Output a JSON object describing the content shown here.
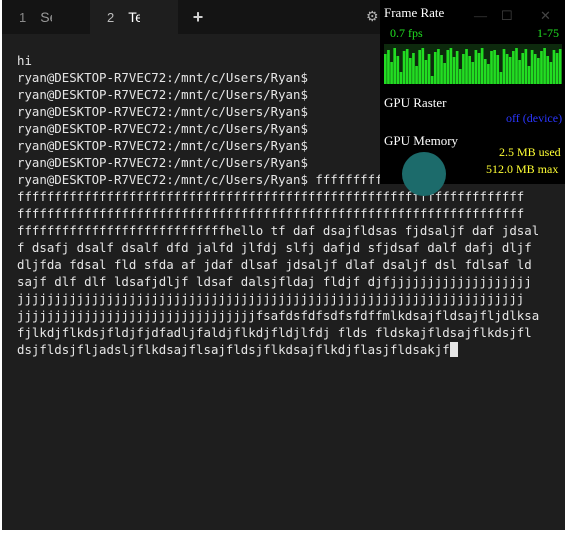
{
  "tabs": [
    {
      "number": "1",
      "title": "Se"
    },
    {
      "number": "2",
      "title": "Te"
    }
  ],
  "new_tab_icon": "+",
  "terminal_lines": [
    "hi",
    "ryan@DESKTOP-R7VEC72:/mnt/c/Users/Ryan$",
    "ryan@DESKTOP-R7VEC72:/mnt/c/Users/Ryan$",
    "ryan@DESKTOP-R7VEC72:/mnt/c/Users/Ryan$",
    "ryan@DESKTOP-R7VEC72:/mnt/c/Users/Ryan$",
    "ryan@DESKTOP-R7VEC72:/mnt/c/Users/Ryan$",
    "ryan@DESKTOP-R7VEC72:/mnt/c/Users/Ryan$",
    "ryan@DESKTOP-R7VEC72:/mnt/c/Users/Ryan$ ffffffffffffffffffffffffffffffff",
    "ffffffffffffffffffffffffffffffffffffffffffffffffffffffffffffffffffff",
    "ffffffffffffffffffffffffffffffffffffffffffffffffffffffffffffffffffff",
    "ffffffffffffffffffffffffffffhello tf daf dsajfldsas fjdsaljf daf jdsal",
    "f dsafj dsalf dsalf dfd jalfd jlfdj slfj dafjd sfjdsaf dalf dafj dljf",
    "dljfda fdsal fld sfda af jdaf dlsaf jdsaljf dlaf dsaljf dsl fdlsaf ld",
    "sajf dlf dlf ldsafjdljf ldsaf dalsjfldaj fldjf djfjjjjjjjjjjjjjjjjjjj",
    "jjjjjjjjjjjjjjjjjjjjjjjjjjjjjjjjjjjjjjjjjjjjjjjjjjjjjjjjjjjjjjjjjjjj",
    "jjjjjjjjjjjjjjjjjjjjjjjjjjjjjjjjfsafdsfdfsdfsfdffmlkdsajfldsajfljdlksa",
    "fjlkdjflkdsjfldjfjdfadljfaldjflkdjfldjlfdj flds fldskajfldsajflkdsjfl",
    "dsjfldsjfljadsljflkdsajflsajfldsjflkdsajflkdjflasjfldsakjf"
  ],
  "overlay": {
    "frame_rate_label": "Frame Rate",
    "fps_value": "0.7 fps",
    "fps_range": "1-75",
    "gpu_raster_label": "GPU Raster",
    "gpu_raster_status": "off (device)",
    "gpu_memory_label": "GPU Memory",
    "memory_used": "2.5 MB used",
    "memory_max": "512.0 MB max"
  },
  "colors": {
    "background": "#1e1e1e",
    "tabbar": "#141414",
    "text": "#e6e6e6",
    "fps_green": "#21e021",
    "raster_blue": "#2b36ff",
    "memory_yellow": "#ffff33"
  },
  "icons": {
    "new_tab": "plus-icon",
    "settings": "gear-icon",
    "cursor": "block-cursor"
  }
}
